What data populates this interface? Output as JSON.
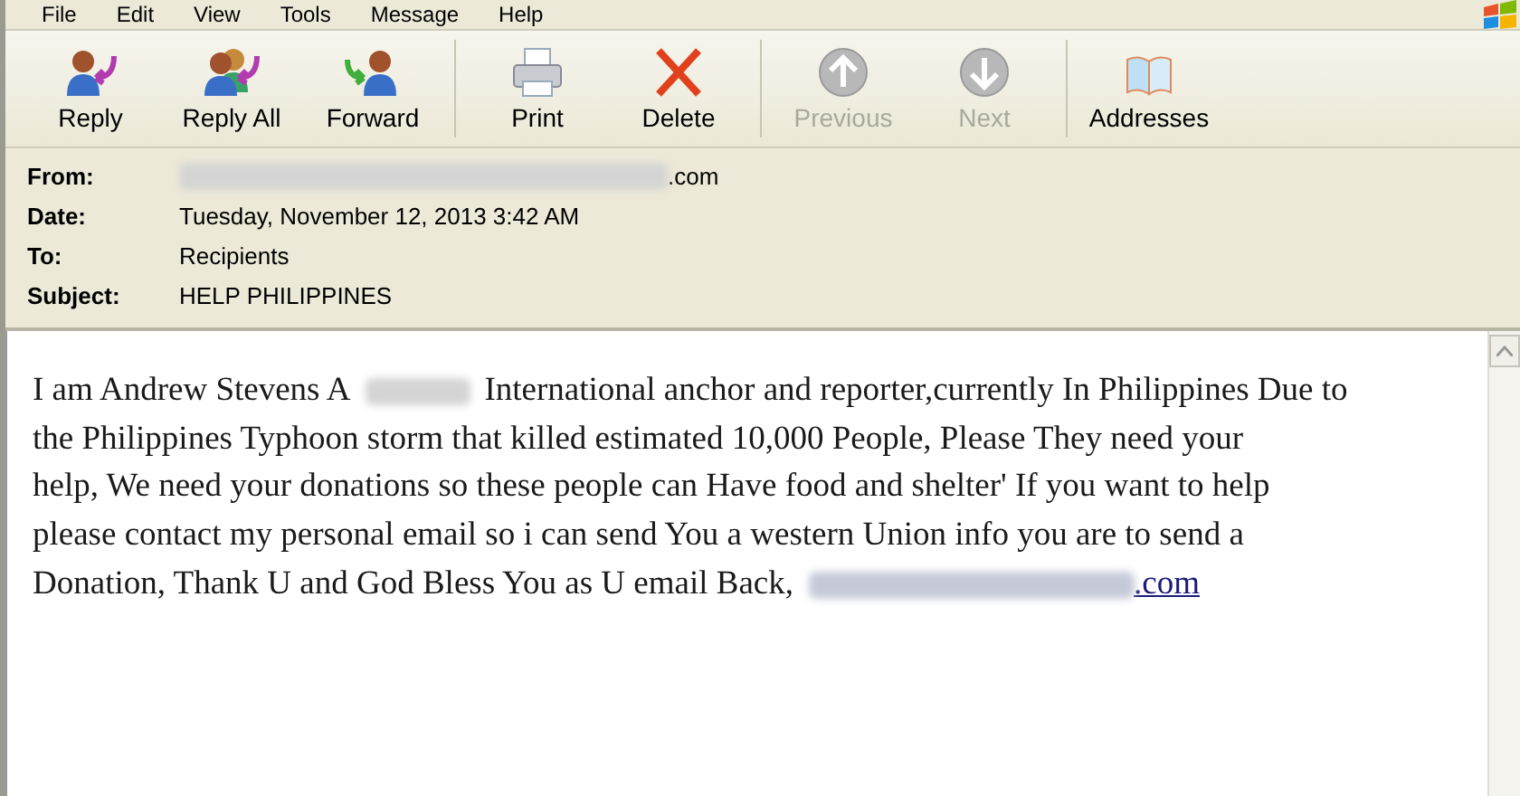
{
  "menu": [
    "File",
    "Edit",
    "View",
    "Tools",
    "Message",
    "Help"
  ],
  "toolbar": [
    {
      "label": "Reply",
      "kind": "reply",
      "disabled": false
    },
    {
      "label": "Reply All",
      "kind": "reply-all",
      "disabled": false
    },
    {
      "label": "Forward",
      "kind": "forward",
      "disabled": false
    },
    {
      "label": "Print",
      "kind": "print",
      "disabled": false
    },
    {
      "label": "Delete",
      "kind": "delete",
      "disabled": false
    },
    {
      "label": "Previous",
      "kind": "previous",
      "disabled": true
    },
    {
      "label": "Next",
      "kind": "next",
      "disabled": true
    },
    {
      "label": "Addresses",
      "kind": "addresses",
      "disabled": false
    }
  ],
  "header": [
    {
      "label": "From:",
      "value": ".com",
      "redacted": true
    },
    {
      "label": "Date:",
      "value": "Tuesday, November 12, 2013 3:42 AM",
      "redacted": false
    },
    {
      "label": "To:",
      "value": "Recipients",
      "redacted": false
    },
    {
      "label": "Subject:",
      "value": "HELP PHILIPPINES",
      "redacted": false
    }
  ],
  "body": [
    [
      {
        "kind": "text",
        "text": "I am Andrew Stevens A"
      },
      {
        "kind": "redacted"
      },
      {
        "kind": "text",
        "text": "International anchor and reporter,currently In Philippines Due to"
      }
    ],
    [
      {
        "kind": "text",
        "text": "the Philippines Typhoon storm that killed estimated 10,000 People, Please They need your"
      }
    ],
    [
      {
        "kind": "text",
        "text": "help, We need your donations so these people can Have food and shelter' If you want to help"
      }
    ],
    [
      {
        "kind": "text",
        "text": "please contact my personal email so i can send You a western Union info you are to send a"
      }
    ],
    [
      {
        "kind": "text",
        "text": "Donation, Thank U and God Bless You as U email Back,"
      },
      {
        "kind": "link",
        "text": ".com"
      }
    ]
  ]
}
